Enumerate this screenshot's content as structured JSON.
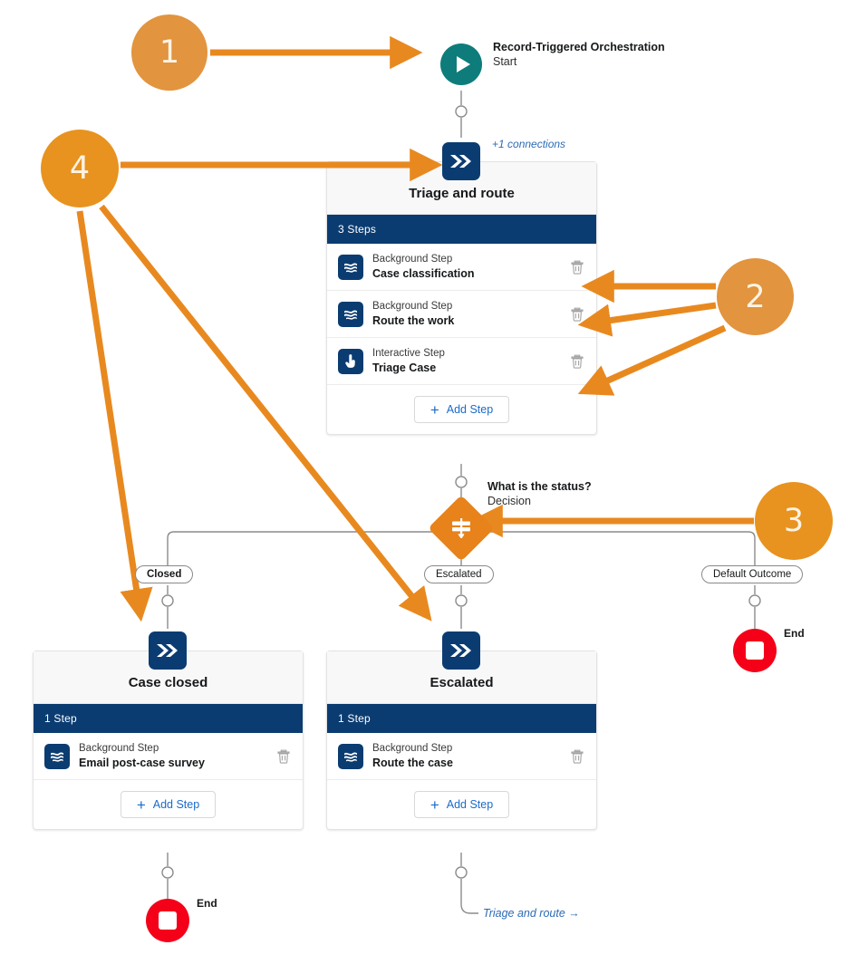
{
  "diagram": {
    "title": "Record-Triggered Orchestration flow canvas",
    "colors": {
      "accent_navy": "#0B3C71",
      "accent_orange": "#E8821A",
      "callout_orange": "#E2943E",
      "start_teal": "#0E7C7B",
      "end_red": "#F50019",
      "link_blue": "#2C6BB5",
      "connector_gray": "#8C8C8C"
    },
    "start": {
      "icon": "play-icon",
      "title": "Record-Triggered Orchestration",
      "subtitle": "Start"
    },
    "connections_label": "+1 connections",
    "stages": [
      {
        "id": "triage-and-route",
        "badge_icon": "double-chevron-icon",
        "title": "Triage and route",
        "steps_count_label": "3 Steps",
        "steps": [
          {
            "kind": "Background Step",
            "name": "Case classification",
            "icon": "background-step-icon",
            "delete_icon": "trash-icon"
          },
          {
            "kind": "Background Step",
            "name": "Route the work",
            "icon": "background-step-icon",
            "delete_icon": "trash-icon"
          },
          {
            "kind": "Interactive Step",
            "name": "Triage Case",
            "icon": "interactive-step-icon",
            "delete_icon": "trash-icon"
          }
        ],
        "add_step_label": "Add Step"
      },
      {
        "id": "case-closed",
        "badge_icon": "double-chevron-icon",
        "title": "Case closed",
        "steps_count_label": "1 Step",
        "steps": [
          {
            "kind": "Background Step",
            "name": "Email post-case survey",
            "icon": "background-step-icon",
            "delete_icon": "trash-icon"
          }
        ],
        "add_step_label": "Add Step"
      },
      {
        "id": "escalated",
        "badge_icon": "double-chevron-icon",
        "title": "Escalated",
        "steps_count_label": "1 Step",
        "steps": [
          {
            "kind": "Background Step",
            "name": "Route the case",
            "icon": "background-step-icon",
            "delete_icon": "trash-icon"
          }
        ],
        "add_step_label": "Add Step"
      }
    ],
    "decision": {
      "icon": "decision-signpost-icon",
      "title": "What is the status?",
      "subtitle": "Decision",
      "outcomes": [
        {
          "label": "Closed",
          "bold": true
        },
        {
          "label": "Escalated",
          "bold": false
        },
        {
          "label": "Default Outcome",
          "bold": false
        }
      ]
    },
    "end_nodes": [
      {
        "id": "end-default-outcome",
        "label": "End",
        "icon": "stop-icon"
      },
      {
        "id": "end-case-closed",
        "label": "End",
        "icon": "stop-icon"
      }
    ],
    "goto_link": {
      "label": "Triage and route",
      "arrow": "→"
    },
    "callouts": [
      {
        "number": "1",
        "points_to": "start-node"
      },
      {
        "number": "2",
        "points_to": "triage-and-route-steps"
      },
      {
        "number": "3",
        "points_to": "decision-diamond"
      },
      {
        "number": "4",
        "points_to": "stage-badges"
      }
    ]
  }
}
